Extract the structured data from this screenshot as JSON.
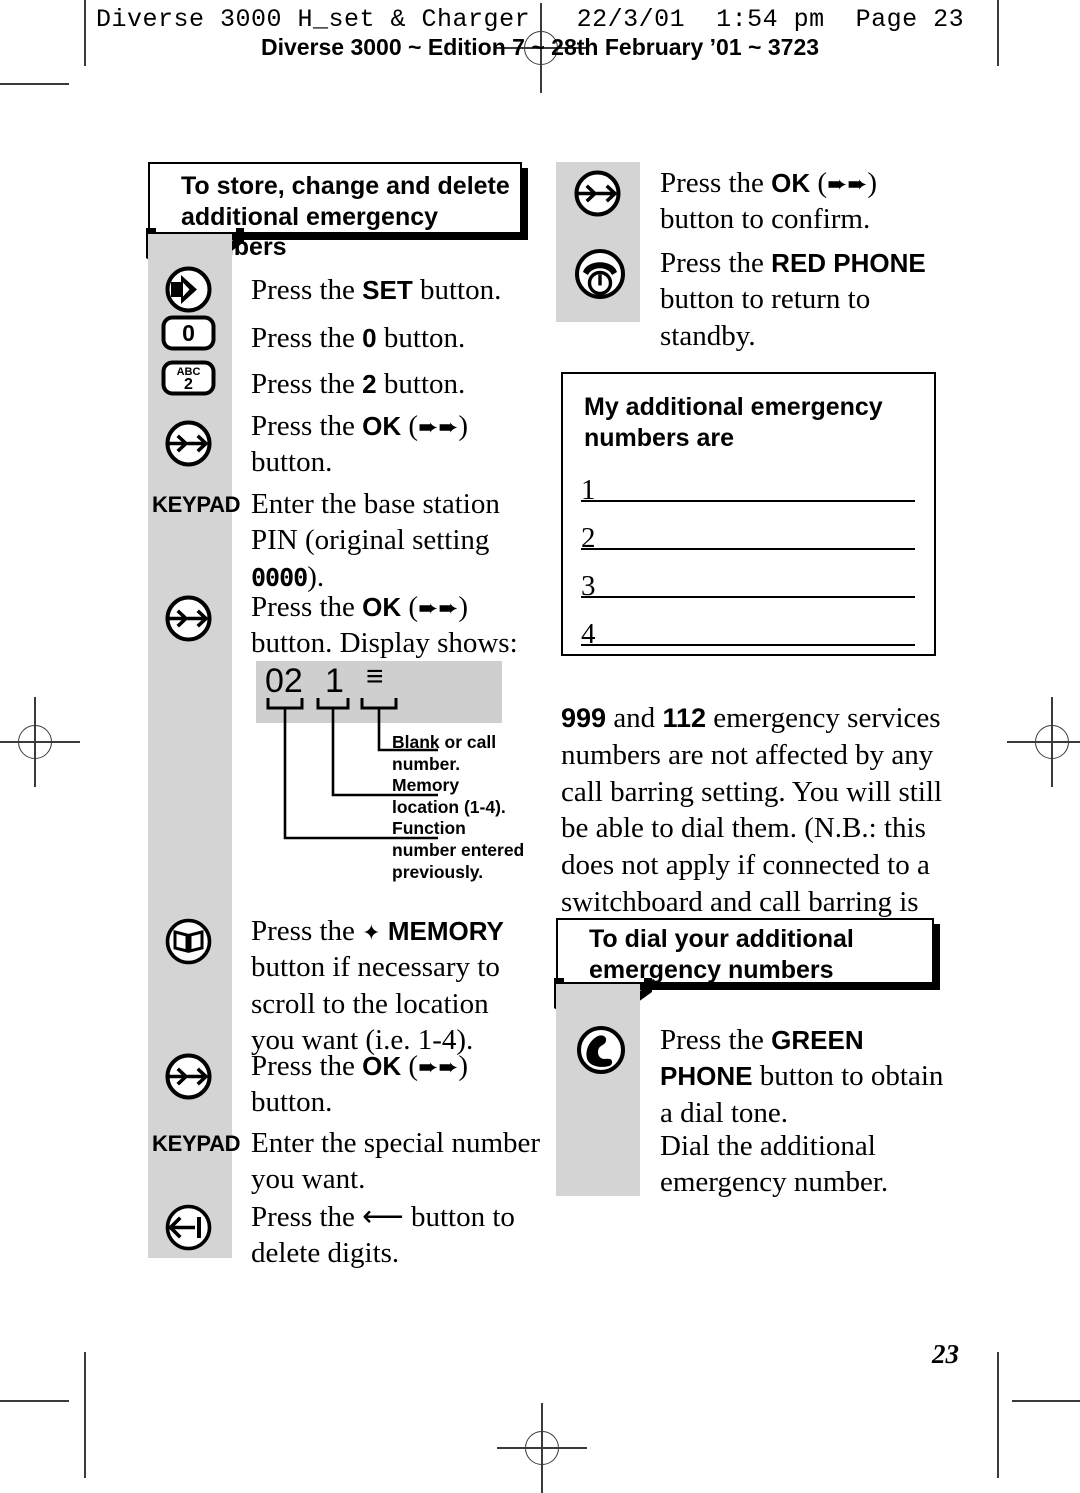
{
  "header": {
    "print_slug": "Diverse 3000 H_set & Charger   22/3/01  1:54 pm  Page 23",
    "edition_line": "Diverse 3000 ~ Edition 7 ~ 28th February ’01 ~ 3723"
  },
  "page_number": "23",
  "left_column": {
    "banner_title_line1": "To store, change and delete",
    "banner_title_line2": "additional emergency numbers",
    "steps": [
      {
        "icon": "set-button-icon",
        "icon_label": "",
        "text_html": "Press the <b>SET</b> button."
      },
      {
        "icon": "key-0-icon",
        "icon_label": "0",
        "text_html": "Press the <b>0</b> button."
      },
      {
        "icon": "key-2-abc-icon",
        "icon_label": "2",
        "icon_sublabel": "ABC",
        "text_html": "Press the <b>2</b> button."
      },
      {
        "icon": "ok-button-icon",
        "icon_label": "",
        "text_html": "Press the <b>OK</b> (➨➨) button."
      },
      {
        "icon": "keypad-label",
        "icon_label": "KEYPAD",
        "text_html": "Enter the base station PIN (original setting <span class=\"lcdfont\">0000</span>)."
      },
      {
        "icon": "ok-button-icon",
        "icon_label": "",
        "text_html": "Press the <b>OK</b> (➨➨) button. Display shows:"
      },
      {
        "icon": "memory-button-icon",
        "icon_label": "",
        "text_html": "Press the ✦ <b>MEMORY</b> button if necessary to scroll to the location you want (i.e. 1-4)."
      },
      {
        "icon": "ok-button-icon",
        "icon_label": "",
        "text_html": "Press the <b>OK</b> (➨➨) button."
      },
      {
        "icon": "keypad-label",
        "icon_label": "KEYPAD",
        "text_html": "Enter the special number you want."
      },
      {
        "icon": "delete-button-icon",
        "icon_label": "",
        "text_html": "Press the ⟵ button to delete digits."
      }
    ],
    "display_diagram": {
      "screen_chars": [
        "02",
        "1",
        "≡"
      ],
      "callouts": [
        "Blank or call number.",
        "Memory location (1-4).",
        "Function number entered previously."
      ]
    }
  },
  "right_column": {
    "steps_top": [
      {
        "icon": "ok-button-icon",
        "text_html": "Press the <b>OK</b> (➨➨) button to confirm."
      },
      {
        "icon": "red-phone-button-icon",
        "text_html": "Press the <b>RED PHONE</b> button to return to standby."
      }
    ],
    "write_in_box": {
      "title_line1": "My additional emergency",
      "title_line2": "numbers are",
      "rows": [
        "1",
        "2",
        "3",
        "4"
      ]
    },
    "note_paragraph_html": "<b>999</b> and <b>112</b> emergency services numbers are not affected by any call barring setting. You will still be able to dial them. (N.B.: this does not apply if connected to a switchboard and call barring is set).",
    "banner_title_line1": "To dial your additional",
    "banner_title_line2": "emergency numbers",
    "steps_bottom": [
      {
        "icon": "green-phone-button-icon",
        "text_html": "Press the <b>GREEN PHONE</b> button to obtain a dial tone."
      },
      {
        "icon": "none",
        "text_html": "Dial the additional emergency number."
      }
    ]
  },
  "colors": {
    "rail_gray": "#d4d4d4",
    "lcd_gray": "#cfcfcf",
    "ink": "#000000",
    "mark_gray": "#3a3a3a"
  }
}
